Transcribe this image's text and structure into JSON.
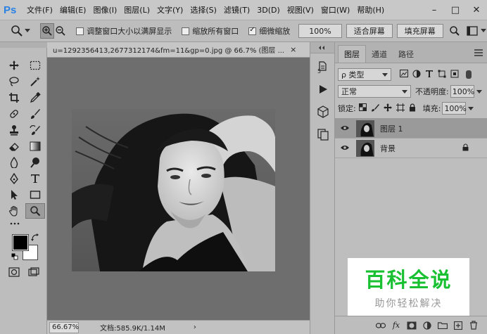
{
  "app": {
    "logo": "Ps"
  },
  "menu": [
    "文件(F)",
    "编辑(E)",
    "图像(I)",
    "图层(L)",
    "文字(Y)",
    "选择(S)",
    "滤镜(T)",
    "3D(D)",
    "视图(V)",
    "窗口(W)",
    "帮助(H)"
  ],
  "window_controls": {
    "minimize": "–",
    "maximize": "□",
    "close": "✕"
  },
  "options": {
    "resize_windows_label": "调整窗口大小以满屏显示",
    "resize_windows_checked": false,
    "zoom_all_label": "缩放所有窗口",
    "zoom_all_checked": false,
    "scrubby_zoom_label": "细微缩放",
    "scrubby_zoom_checked": true,
    "zoom_percent": "100%",
    "fit_screen_label": "适合屏幕",
    "fill_screen_label": "填充屏幕"
  },
  "document": {
    "tab_title": "u=1292356413,2677312174&fm=11&gp=0.jpg @ 66.7% (图层 ...",
    "tab_close": "×",
    "status_zoom": "66.67%",
    "status_doc": "文档:585.9K/1.14M",
    "status_arrow": "›"
  },
  "layers_panel": {
    "tabs": [
      "图层",
      "通道",
      "路径"
    ],
    "filter_label": "ρ 类型",
    "blend_mode": "正常",
    "opacity_label": "不透明度:",
    "opacity_value": "100%",
    "lock_label": "锁定:",
    "fill_label": "填充:",
    "fill_value": "100%",
    "layers": [
      {
        "name": "图层 1",
        "visible": true,
        "selected": true,
        "locked": false
      },
      {
        "name": "背景",
        "visible": true,
        "selected": false,
        "locked": true
      }
    ]
  },
  "watermark": {
    "title": "百科全说",
    "subtitle": "助你轻松解决"
  },
  "colors": {
    "accent": "#2a82e4",
    "watermark_green": "#19c132",
    "canvas_bg": "#6e6e6e"
  }
}
